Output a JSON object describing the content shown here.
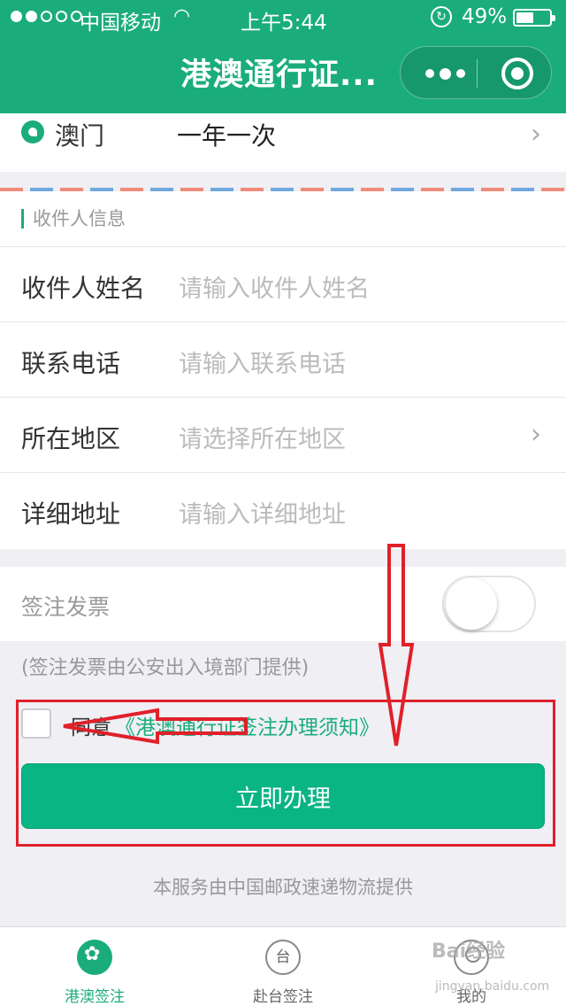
{
  "status": {
    "carrier": "中国移动",
    "time": "上午5:44",
    "battery": "49%"
  },
  "nav": {
    "title": "港澳通行证..."
  },
  "destination": {
    "name": "澳门",
    "value": "一年一次"
  },
  "recipient": {
    "section_label": "收件人信息",
    "fields": [
      {
        "label": "收件人姓名",
        "placeholder": "请输入收件人姓名"
      },
      {
        "label": "联系电话",
        "placeholder": "请输入联系电话"
      },
      {
        "label": "所在地区",
        "placeholder": "请选择所在地区"
      },
      {
        "label": "详细地址",
        "placeholder": "请输入详细地址"
      }
    ]
  },
  "invoice": {
    "label": "签注发票",
    "note": "(签注发票由公安出入境部门提供)",
    "enabled": false
  },
  "agreement": {
    "text": "同意",
    "link": "《港澳通行证签注办理须知》",
    "checked": false
  },
  "submit": {
    "label": "立即办理"
  },
  "footer": {
    "note": "本服务由中国邮政速递物流提供"
  },
  "tabs": [
    {
      "label": "港澳签注",
      "active": true
    },
    {
      "label": "赴台签注",
      "icon_text": "台",
      "active": false
    },
    {
      "label": "我的",
      "active": false
    }
  ],
  "watermark": {
    "text": "Bai经验",
    "url": "jingyan.baidu.com"
  },
  "colors": {
    "brand": "#1aad7b",
    "annotation": "#e0202a"
  }
}
